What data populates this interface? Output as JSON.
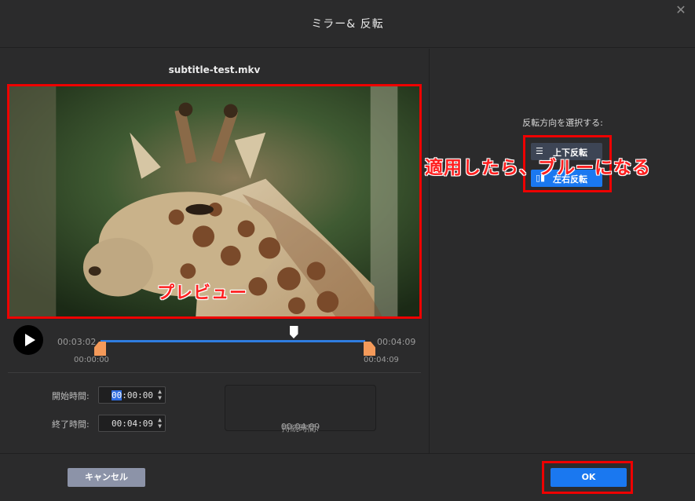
{
  "dialog": {
    "title": "ミラー& 反転",
    "close_icon": "close-icon"
  },
  "preview": {
    "filename": "subtitle-test.mkv",
    "annotation": "プレビュー"
  },
  "timeline": {
    "current_time": "00:03:02",
    "total_time": "00:04:09",
    "start_marker": "00:00:00",
    "end_marker": "00:04:09",
    "playhead_fraction": 0.73,
    "accent_color": "#2f7de1",
    "handle_color": "#f49a5a"
  },
  "trim": {
    "start_label": "開始時間:",
    "start_value_highlight": "00",
    "start_value_rest": ":00:00",
    "end_label": "終了時間:",
    "end_value": "00:04:09",
    "duration_label": "持続時間: ",
    "duration_value": "00:04:09"
  },
  "flip": {
    "title": "反転方向を選択する:",
    "vertical_label": "上下反転",
    "horizontal_label": "左右反転",
    "annotation": "適用したら、ブルーになる"
  },
  "footer": {
    "cancel_label": "キャンセル",
    "ok_label": "OK"
  }
}
